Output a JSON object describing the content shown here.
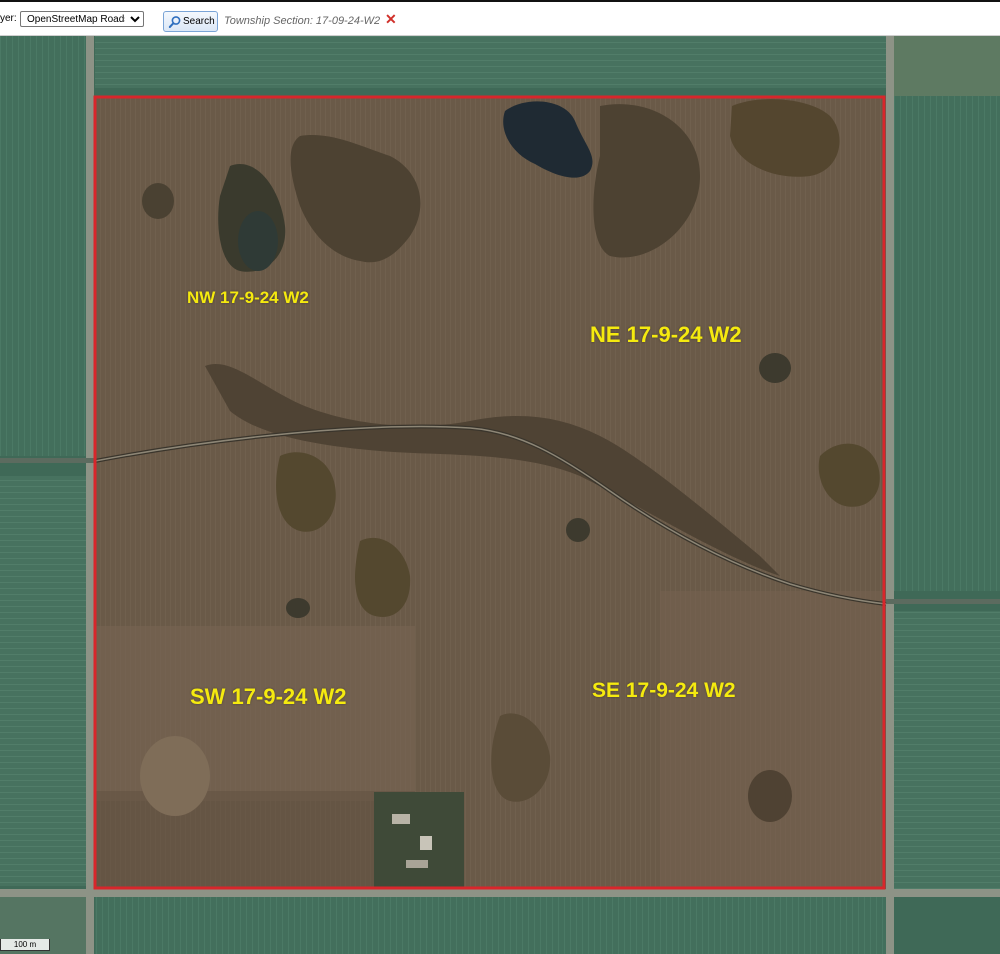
{
  "toolbar": {
    "layer_label": "yer:",
    "layer_selected": "OpenStreetMap Roads",
    "search_label": "Search",
    "section_text": "Township Section: 17-09-24-W2",
    "clear_symbol": "✕"
  },
  "map": {
    "quarter_labels": {
      "nw": "NW 17-9-24 W2",
      "ne": "NE 17-9-24 W2",
      "sw": "SW 17-9-24 W2",
      "se": "SE 17-9-24 W2"
    },
    "scale_label": "100 m",
    "colors": {
      "boundary": "#d8262b",
      "label": "#f5ea0f",
      "field_green": "#3e6b58",
      "field_brown": "#6a5846"
    }
  }
}
